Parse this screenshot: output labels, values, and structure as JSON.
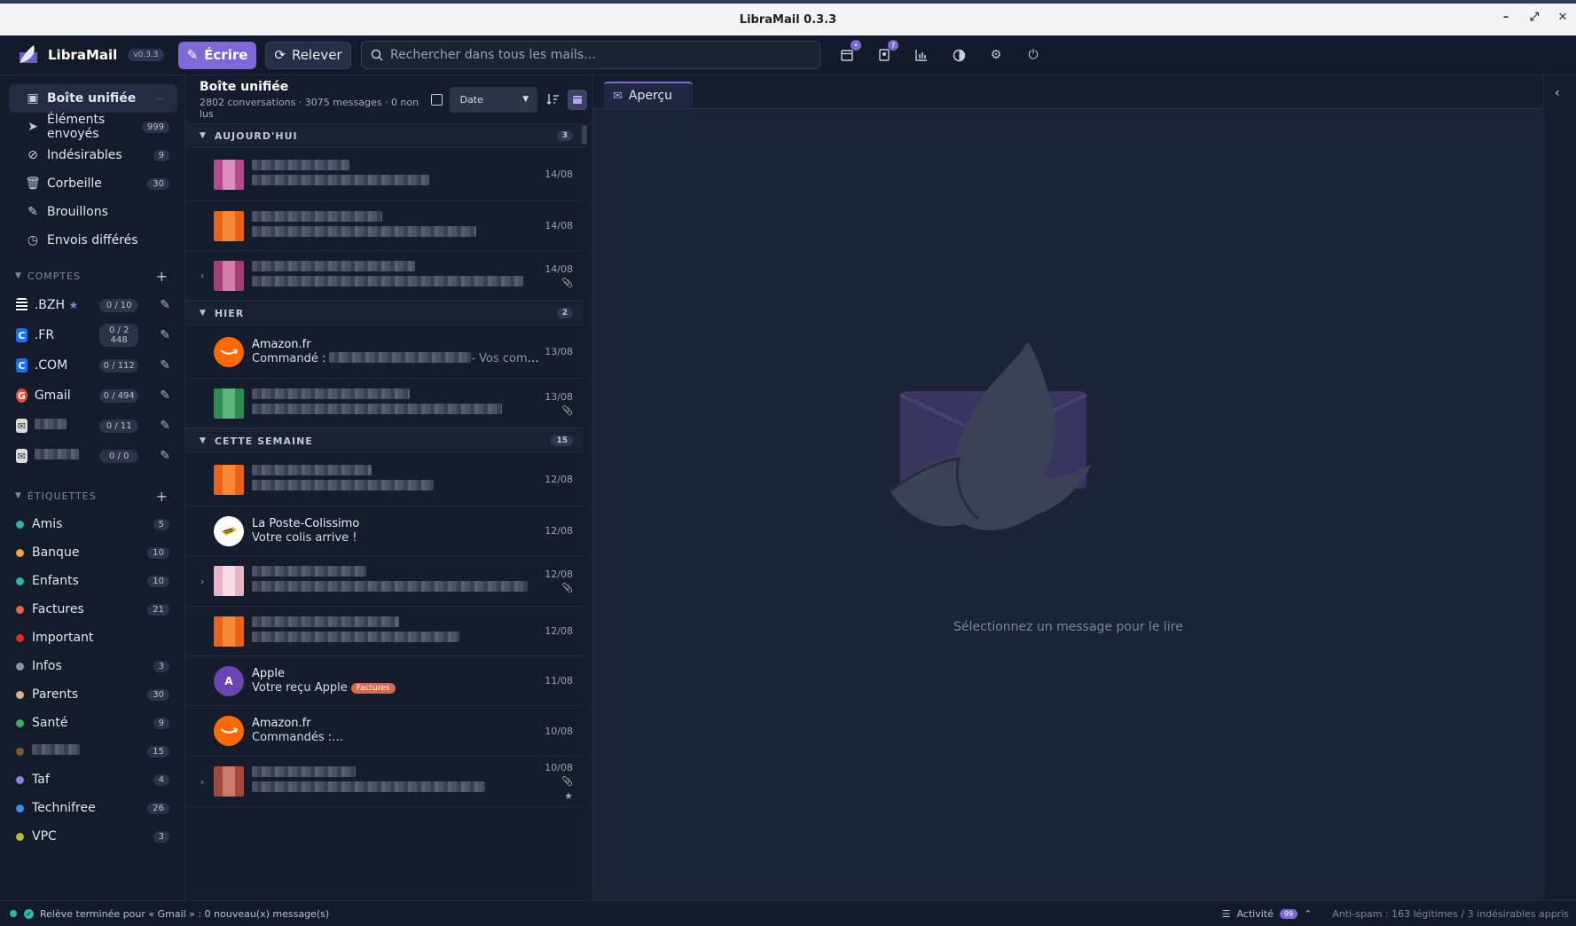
{
  "window": {
    "title": "LibraMail 0.3.3"
  },
  "header": {
    "app_name": "LibraMail",
    "version": "v0.3.3",
    "compose_label": "Écrire",
    "fetch_label": "Relever",
    "search_placeholder": "Rechercher dans tous les mails…",
    "calendar_badge": "•",
    "contacts_badge": "7"
  },
  "sidebar": {
    "folders": [
      {
        "label": "Boîte unifiée",
        "count": "—",
        "icon": "inbox-icon"
      },
      {
        "label": "Éléments envoyés",
        "count": "999",
        "icon": "send-icon"
      },
      {
        "label": "Indésirables",
        "count": "9",
        "icon": "ban-icon"
      },
      {
        "label": "Corbeille",
        "count": "30",
        "icon": "trash-icon"
      },
      {
        "label": "Brouillons",
        "count": "",
        "icon": "draft-icon"
      },
      {
        "label": "Envois différés",
        "count": "",
        "icon": "clock-icon"
      }
    ],
    "accounts_title": "COMPTES",
    "accounts": [
      {
        "label": ".BZH",
        "count": "0 / 10",
        "color": "#ffffff"
      },
      {
        "label": ".FR",
        "count": "0 / 2 448",
        "color": "#1e6ff0"
      },
      {
        "label": ".COM",
        "count": "0 / 112",
        "color": "#1e6ff0"
      },
      {
        "label": "Gmail",
        "count": "0 / 494",
        "color": "#e04b3a"
      },
      {
        "label": "",
        "count": "0 / 11",
        "color": "#dcdcdc"
      },
      {
        "label": "",
        "count": "0 / 0",
        "color": "#dcdcdc"
      }
    ],
    "tags_title": "ÉTIQUETTES",
    "tags": [
      {
        "label": "Amis",
        "count": "5",
        "color": "#2fb5a6"
      },
      {
        "label": "Banque",
        "count": "10",
        "color": "#f2a23a"
      },
      {
        "label": "Enfants",
        "count": "10",
        "color": "#2fb5a6"
      },
      {
        "label": "Factures",
        "count": "21",
        "color": "#e2674a"
      },
      {
        "label": "Important",
        "count": "",
        "color": "#e62b2b"
      },
      {
        "label": "Infos",
        "count": "3",
        "color": "#8a93a8"
      },
      {
        "label": "Parents",
        "count": "30",
        "color": "#d9b48c"
      },
      {
        "label": "Santé",
        "count": "9",
        "color": "#3fae62"
      },
      {
        "label": "",
        "count": "15",
        "color": "#7a5a40"
      },
      {
        "label": "Taf",
        "count": "4",
        "color": "#8d7fe0"
      },
      {
        "label": "Technifree",
        "count": "26",
        "color": "#3d8fe6"
      },
      {
        "label": "VPC",
        "count": "3",
        "color": "#b8b83a"
      }
    ]
  },
  "list": {
    "title": "Boîte unifiée",
    "subtitle": "2802 conversations · 3075 messages · 0 non lus",
    "sort_label": "Date",
    "groups": [
      {
        "label": "AUJOURD'HUI",
        "count": "3"
      },
      {
        "label": "HIER",
        "count": "2"
      },
      {
        "label": "CETTE SEMAINE",
        "count": "15"
      }
    ],
    "messages": [
      {
        "sender": "",
        "subject": "",
        "date": "14/08"
      },
      {
        "sender": "",
        "subject": "",
        "date": "14/08"
      },
      {
        "sender": "",
        "subject": "",
        "date": "14/08"
      },
      {
        "sender": "Amazon.fr",
        "subject": "Commandé :",
        "hint": "- Vos commande…",
        "date": "13/08"
      },
      {
        "sender": "",
        "subject": "",
        "date": "13/08"
      },
      {
        "sender": "",
        "subject": "",
        "date": "12/08"
      },
      {
        "sender": "La Poste-Colissimo",
        "subject": "Votre colis arrive !",
        "date": "12/08"
      },
      {
        "sender": "",
        "subject": "",
        "date": "12/08"
      },
      {
        "sender": "",
        "subject": "",
        "date": "12/08"
      },
      {
        "sender": "Apple",
        "subject": "Votre reçu Apple",
        "pill": "Factures",
        "avatar": "A",
        "date": "11/08"
      },
      {
        "sender": "Amazon.fr",
        "subject": "Commandés :",
        "date": "10/08"
      },
      {
        "sender": "",
        "subject": "",
        "date": "10/08"
      }
    ]
  },
  "preview": {
    "tab_label": "Aperçu",
    "empty_message": "Sélectionnez un message pour le lire"
  },
  "status": {
    "message": "Relève terminée pour « Gmail » : 0 nouveau(x) message(s)",
    "activity_label": "Activité",
    "activity_count": "99",
    "antispam": "Anti-spam : 163 légitimes / 3 indésirables appris"
  },
  "colors": {
    "accent": "#7c68d6",
    "background": "#161d2e"
  }
}
